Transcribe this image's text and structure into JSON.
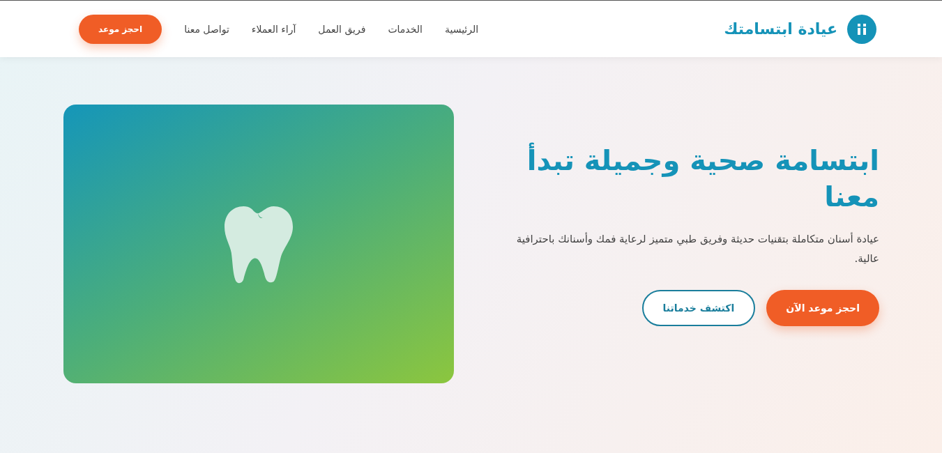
{
  "header": {
    "brand": "عيادة ابتسامتك",
    "nav": [
      "الرئيسية",
      "الخدمات",
      "فريق العمل",
      "آراء العملاء",
      "تواصل معنا"
    ],
    "cta": "احجز موعد"
  },
  "hero": {
    "title": "ابتسامة صحية وجميلة تبدأ معنا",
    "text": "عيادة أسنان متكاملة بتقنيات حديثة وفريق طبي متميز لرعاية فمك وأسنانك باحترافية عالية.",
    "buttons": [
      {
        "label": "احجز موعد الآن",
        "kind": "primary"
      },
      {
        "label": "اكتشف خدماتنا",
        "kind": "outline"
      }
    ]
  }
}
